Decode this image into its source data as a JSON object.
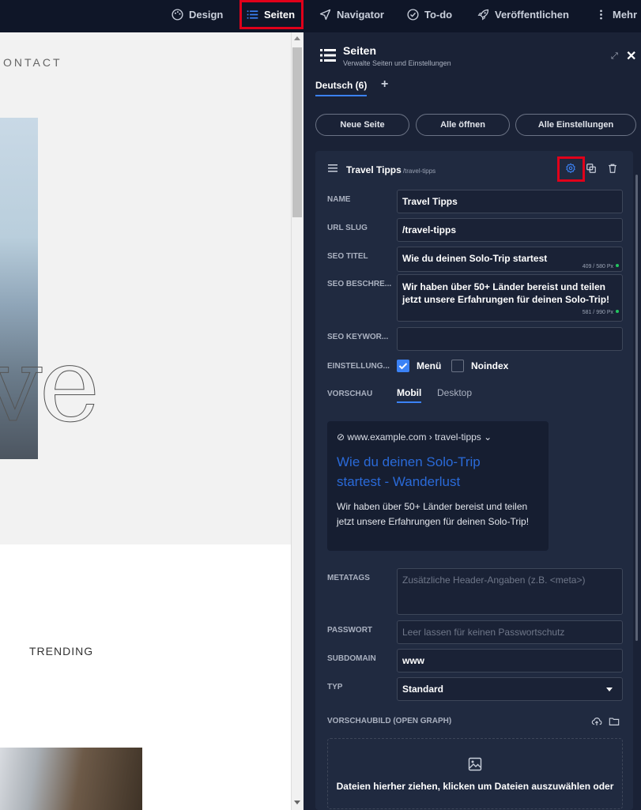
{
  "topbar": {
    "items": [
      {
        "label": "Design",
        "icon": "palette-icon"
      },
      {
        "label": "Seiten",
        "icon": "list-icon",
        "active": true
      },
      {
        "label": "Navigator",
        "icon": "navigation-arrow-icon"
      },
      {
        "label": "To-do",
        "icon": "check-circle-icon"
      },
      {
        "label": "Veröffentlichen",
        "icon": "rocket-icon"
      },
      {
        "label": "Mehr",
        "icon": "more-vertical-icon"
      }
    ]
  },
  "site": {
    "contact": "ONTACT",
    "big_text": "ve",
    "trending": "TRENDING"
  },
  "panel": {
    "title": "Seiten",
    "subtitle": "Verwalte Seiten und Einstellungen",
    "language_tab": "Deutsch (6)",
    "add": "+",
    "buttons": {
      "new_page": "Neue Seite",
      "open_all": "Alle öffnen",
      "all_settings": "Alle Einstellungen"
    },
    "page": {
      "title": "Travel Tipps",
      "slug": "/travel-tipps",
      "labels": {
        "name": "NAME",
        "url_slug": "URL SLUG",
        "seo_title": "SEO TITEL",
        "seo_description": "SEO BESCHRE...",
        "seo_keywords": "SEO KEYWOR...",
        "settings": "EINSTELLUNG...",
        "preview": "VORSCHAU",
        "metatags": "METATAGS",
        "password": "PASSWORT",
        "subdomain": "SUBDOMAIN",
        "type": "TYP",
        "og_image": "VORSCHAUBILD (OPEN GRAPH)"
      },
      "values": {
        "name": "Travel Tipps",
        "url_slug": "/travel-tipps",
        "seo_title": "Wie du deinen Solo-Trip startest",
        "seo_title_counter": "409 / 580 Px",
        "seo_description": "Wir haben über 50+ Länder bereist und teilen jetzt unsere Erfahrungen für deinen Solo-Trip!",
        "seo_description_counter": "581 / 990 Px",
        "seo_keywords": "",
        "subdomain": "www",
        "type": "Standard"
      },
      "placeholders": {
        "metatags": "Zusätzliche Header-Angaben (z.B. <meta>)",
        "password": "Leer lassen für keinen Passwortschutz"
      },
      "checkboxes": {
        "menu": {
          "label": "Menü",
          "checked": true
        },
        "noindex": {
          "label": "Noindex",
          "checked": false
        }
      },
      "preview_tabs": {
        "mobile": "Mobil",
        "desktop": "Desktop"
      },
      "serp": {
        "url": "www.example.com › travel-tipps ⌄",
        "title": "Wie du deinen Solo-Trip startest - Wanderlust",
        "description": "Wir haben über 50+ Länder bereist und teilen jetzt unsere Erfahrungen für deinen Solo-Trip!"
      },
      "dropzone": {
        "text": "Dateien hierher ziehen, klicken um Dateien auszuwählen oder"
      }
    }
  },
  "colors": {
    "accent": "#3b82f6",
    "highlight": "#e0001a",
    "panel_bg": "#1a2236",
    "serp_link": "#2a6ad8"
  }
}
